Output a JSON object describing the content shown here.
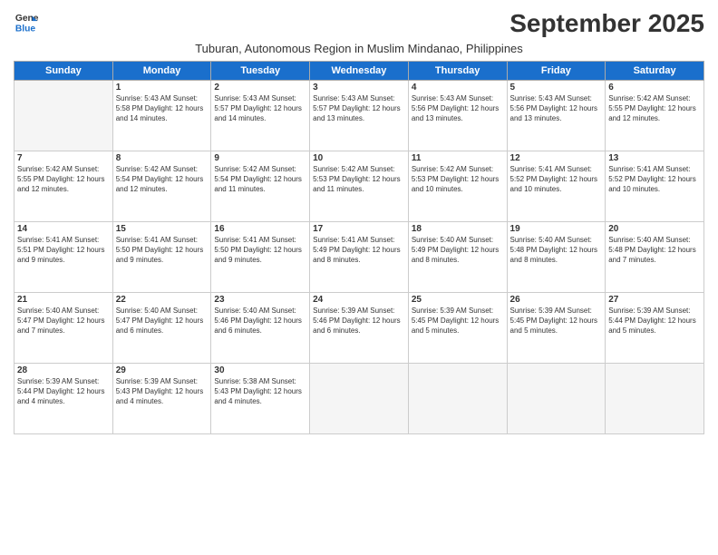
{
  "logo": {
    "line1": "General",
    "line2": "Blue"
  },
  "title": "September 2025",
  "subtitle": "Tuburan, Autonomous Region in Muslim Mindanao, Philippines",
  "days_of_week": [
    "Sunday",
    "Monday",
    "Tuesday",
    "Wednesday",
    "Thursday",
    "Friday",
    "Saturday"
  ],
  "weeks": [
    [
      {
        "day": "",
        "info": ""
      },
      {
        "day": "1",
        "info": "Sunrise: 5:43 AM\nSunset: 5:58 PM\nDaylight: 12 hours\nand 14 minutes."
      },
      {
        "day": "2",
        "info": "Sunrise: 5:43 AM\nSunset: 5:57 PM\nDaylight: 12 hours\nand 14 minutes."
      },
      {
        "day": "3",
        "info": "Sunrise: 5:43 AM\nSunset: 5:57 PM\nDaylight: 12 hours\nand 13 minutes."
      },
      {
        "day": "4",
        "info": "Sunrise: 5:43 AM\nSunset: 5:56 PM\nDaylight: 12 hours\nand 13 minutes."
      },
      {
        "day": "5",
        "info": "Sunrise: 5:43 AM\nSunset: 5:56 PM\nDaylight: 12 hours\nand 13 minutes."
      },
      {
        "day": "6",
        "info": "Sunrise: 5:42 AM\nSunset: 5:55 PM\nDaylight: 12 hours\nand 12 minutes."
      }
    ],
    [
      {
        "day": "7",
        "info": "Sunrise: 5:42 AM\nSunset: 5:55 PM\nDaylight: 12 hours\nand 12 minutes."
      },
      {
        "day": "8",
        "info": "Sunrise: 5:42 AM\nSunset: 5:54 PM\nDaylight: 12 hours\nand 12 minutes."
      },
      {
        "day": "9",
        "info": "Sunrise: 5:42 AM\nSunset: 5:54 PM\nDaylight: 12 hours\nand 11 minutes."
      },
      {
        "day": "10",
        "info": "Sunrise: 5:42 AM\nSunset: 5:53 PM\nDaylight: 12 hours\nand 11 minutes."
      },
      {
        "day": "11",
        "info": "Sunrise: 5:42 AM\nSunset: 5:53 PM\nDaylight: 12 hours\nand 10 minutes."
      },
      {
        "day": "12",
        "info": "Sunrise: 5:41 AM\nSunset: 5:52 PM\nDaylight: 12 hours\nand 10 minutes."
      },
      {
        "day": "13",
        "info": "Sunrise: 5:41 AM\nSunset: 5:52 PM\nDaylight: 12 hours\nand 10 minutes."
      }
    ],
    [
      {
        "day": "14",
        "info": "Sunrise: 5:41 AM\nSunset: 5:51 PM\nDaylight: 12 hours\nand 9 minutes."
      },
      {
        "day": "15",
        "info": "Sunrise: 5:41 AM\nSunset: 5:50 PM\nDaylight: 12 hours\nand 9 minutes."
      },
      {
        "day": "16",
        "info": "Sunrise: 5:41 AM\nSunset: 5:50 PM\nDaylight: 12 hours\nand 9 minutes."
      },
      {
        "day": "17",
        "info": "Sunrise: 5:41 AM\nSunset: 5:49 PM\nDaylight: 12 hours\nand 8 minutes."
      },
      {
        "day": "18",
        "info": "Sunrise: 5:40 AM\nSunset: 5:49 PM\nDaylight: 12 hours\nand 8 minutes."
      },
      {
        "day": "19",
        "info": "Sunrise: 5:40 AM\nSunset: 5:48 PM\nDaylight: 12 hours\nand 8 minutes."
      },
      {
        "day": "20",
        "info": "Sunrise: 5:40 AM\nSunset: 5:48 PM\nDaylight: 12 hours\nand 7 minutes."
      }
    ],
    [
      {
        "day": "21",
        "info": "Sunrise: 5:40 AM\nSunset: 5:47 PM\nDaylight: 12 hours\nand 7 minutes."
      },
      {
        "day": "22",
        "info": "Sunrise: 5:40 AM\nSunset: 5:47 PM\nDaylight: 12 hours\nand 6 minutes."
      },
      {
        "day": "23",
        "info": "Sunrise: 5:40 AM\nSunset: 5:46 PM\nDaylight: 12 hours\nand 6 minutes."
      },
      {
        "day": "24",
        "info": "Sunrise: 5:39 AM\nSunset: 5:46 PM\nDaylight: 12 hours\nand 6 minutes."
      },
      {
        "day": "25",
        "info": "Sunrise: 5:39 AM\nSunset: 5:45 PM\nDaylight: 12 hours\nand 5 minutes."
      },
      {
        "day": "26",
        "info": "Sunrise: 5:39 AM\nSunset: 5:45 PM\nDaylight: 12 hours\nand 5 minutes."
      },
      {
        "day": "27",
        "info": "Sunrise: 5:39 AM\nSunset: 5:44 PM\nDaylight: 12 hours\nand 5 minutes."
      }
    ],
    [
      {
        "day": "28",
        "info": "Sunrise: 5:39 AM\nSunset: 5:44 PM\nDaylight: 12 hours\nand 4 minutes."
      },
      {
        "day": "29",
        "info": "Sunrise: 5:39 AM\nSunset: 5:43 PM\nDaylight: 12 hours\nand 4 minutes."
      },
      {
        "day": "30",
        "info": "Sunrise: 5:38 AM\nSunset: 5:43 PM\nDaylight: 12 hours\nand 4 minutes."
      },
      {
        "day": "",
        "info": ""
      },
      {
        "day": "",
        "info": ""
      },
      {
        "day": "",
        "info": ""
      },
      {
        "day": "",
        "info": ""
      }
    ]
  ]
}
